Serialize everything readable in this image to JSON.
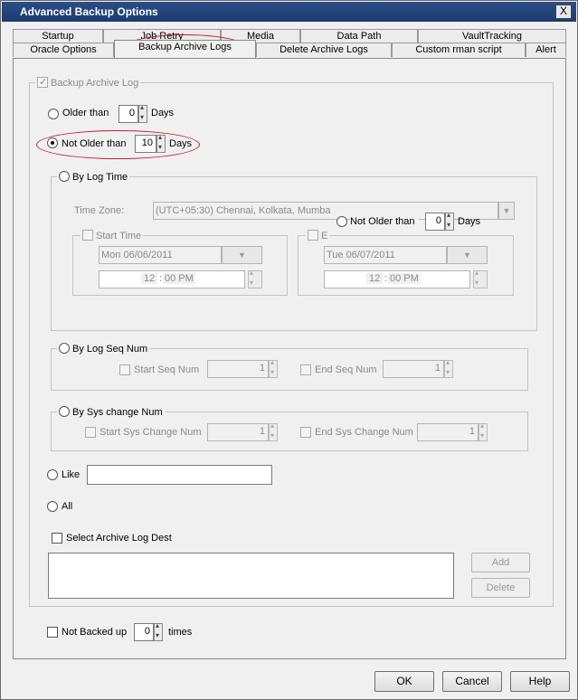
{
  "window": {
    "title": "Advanced Backup Options",
    "close_label": "X"
  },
  "tabs_row1": [
    "Startup",
    "Job Retry",
    "Media",
    "Data Path",
    "VaultTracking"
  ],
  "tabs_row2": [
    "Oracle Options",
    "Backup Archive Logs",
    "Delete Archive Logs",
    "Custom rman script",
    "Alert"
  ],
  "backup_archive_log_label": "Backup Archive Log",
  "older_than": {
    "label": "Older than",
    "value": "0",
    "unit": "Days"
  },
  "not_older_than": {
    "label": "Not Older than",
    "value": "10",
    "unit": "Days"
  },
  "by_log_time": {
    "label": "By Log Time",
    "time_zone_label": "Time Zone:",
    "time_zone_value": "(UTC+05:30) Chennai, Kolkata, Mumba",
    "not_older_label": "Not Older than",
    "not_older_value": "0",
    "not_older_unit": "Days",
    "start_time_label": "Start Time",
    "start_date": "Mon 06/06/2011",
    "start_hour": "12",
    "start_min": "00 PM",
    "end_label": "E",
    "end_date": "Tue 06/07/2011",
    "end_hour": "12",
    "end_min": "00 PM"
  },
  "by_log_seq": {
    "label": "By Log Seq Num",
    "start_label": "Start Seq Num",
    "start_value": "1",
    "end_label": "End Seq Num",
    "end_value": "1"
  },
  "by_sys_change": {
    "label": "By Sys change Num",
    "start_label": "Start Sys Change Num",
    "start_value": "1",
    "end_label": "End Sys Change Num",
    "end_value": "1"
  },
  "like_label": "Like",
  "like_value": "",
  "all_label": "All",
  "select_dest_label": "Select Archive Log Dest",
  "add_label": "Add",
  "delete_label": "Delete",
  "not_backed_up": {
    "label": "Not Backed up",
    "value": "0",
    "unit": "times"
  },
  "footer": {
    "ok": "OK",
    "cancel": "Cancel",
    "help": "Help"
  },
  "colors": {
    "titlebar": "#1d3c6e",
    "annotation": "#c0202a"
  }
}
